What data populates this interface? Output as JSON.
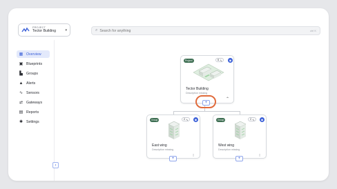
{
  "project": {
    "caption": "PROJECT",
    "name": "Tector Building"
  },
  "search": {
    "placeholder": "Search for anything",
    "shortcut": "ctrl K"
  },
  "sidebar": {
    "items": [
      {
        "label": "Overview",
        "icon": "grid-icon",
        "active": true
      },
      {
        "label": "Blueprints",
        "icon": "blueprint-icon"
      },
      {
        "label": "Groups",
        "icon": "groups-icon"
      },
      {
        "label": "Alerts",
        "icon": "bell-icon"
      },
      {
        "label": "Sensors",
        "icon": "sensor-icon"
      },
      {
        "label": "Gateways",
        "icon": "gateway-icon"
      },
      {
        "label": "Reports",
        "icon": "report-icon"
      },
      {
        "label": "Settings",
        "icon": "gear-icon"
      }
    ],
    "collapse": "‹"
  },
  "root": {
    "badge": "Project",
    "sensors": "6",
    "title": "Tector Building",
    "description": "Description missing",
    "expand": "⌃",
    "add": "+"
  },
  "children": [
    {
      "badge": "Group",
      "sensors": "2",
      "title": "East wing",
      "description": "Description missing",
      "add": "+"
    },
    {
      "badge": "Group",
      "sensors": "2",
      "title": "West wing",
      "description": "Description missing",
      "add": "+"
    }
  ],
  "colors": {
    "accent": "#3a5fd8",
    "highlight": "#e06a3b",
    "badge": "#3d6e52"
  }
}
